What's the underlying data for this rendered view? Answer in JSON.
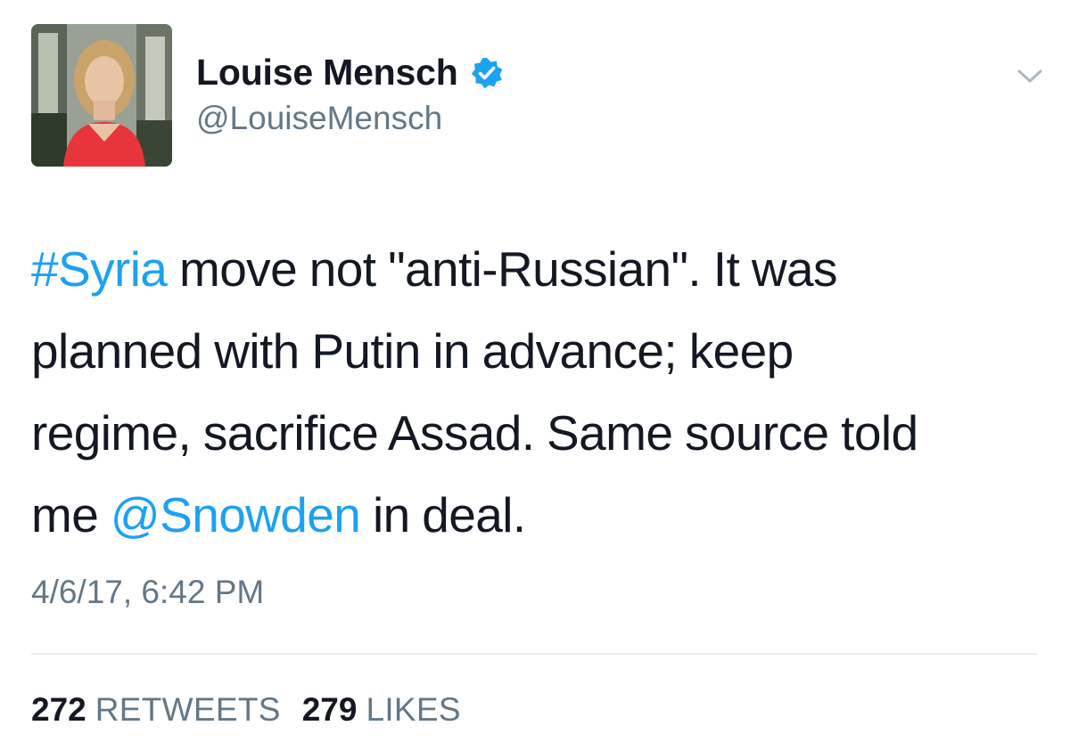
{
  "author": {
    "display_name": "Louise Mensch",
    "handle": "@LouiseMensch",
    "verified_icon": "verified-badge-icon"
  },
  "tweet": {
    "lines": [
      [
        {
          "text": "#Syria",
          "type": "hashtag"
        },
        {
          "text": " move not \"anti-Russian\". It was",
          "type": "text"
        }
      ],
      [
        {
          "text": "planned with Putin in advance; keep",
          "type": "text"
        }
      ],
      [
        {
          "text": "regime, sacrifice Assad. Same source told",
          "type": "text"
        }
      ],
      [
        {
          "text": "me ",
          "type": "text"
        },
        {
          "text": "@Snowden",
          "type": "mention"
        },
        {
          "text": " in deal.",
          "type": "text"
        }
      ]
    ],
    "timestamp": "4/6/17, 6:42 PM"
  },
  "stats": {
    "retweets_count": "272",
    "retweets_label": "RETWEETS",
    "likes_count": "279",
    "likes_label": "LIKES"
  },
  "colors": {
    "link": "#1da1f2",
    "secondary_text": "#657786",
    "primary_text": "#141823",
    "divider": "#e6ecf0"
  }
}
